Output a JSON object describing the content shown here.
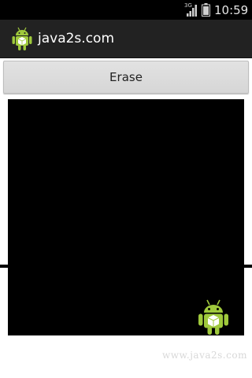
{
  "status_bar": {
    "network": "3G",
    "time": "10:59",
    "signal_icon": "signal-icon",
    "battery_icon": "battery-icon"
  },
  "action_bar": {
    "title": "java2s.com",
    "icon": "android-icon"
  },
  "toolbar": {
    "erase_label": "Erase"
  },
  "canvas": {
    "background_color": "#000000",
    "sprite_icon": "android-icon"
  },
  "watermark": "www.java2s.com",
  "colors": {
    "status_bar": "#000000",
    "action_bar": "#222222",
    "button": "#d9d9d9",
    "android_green": "#9fc93c"
  }
}
